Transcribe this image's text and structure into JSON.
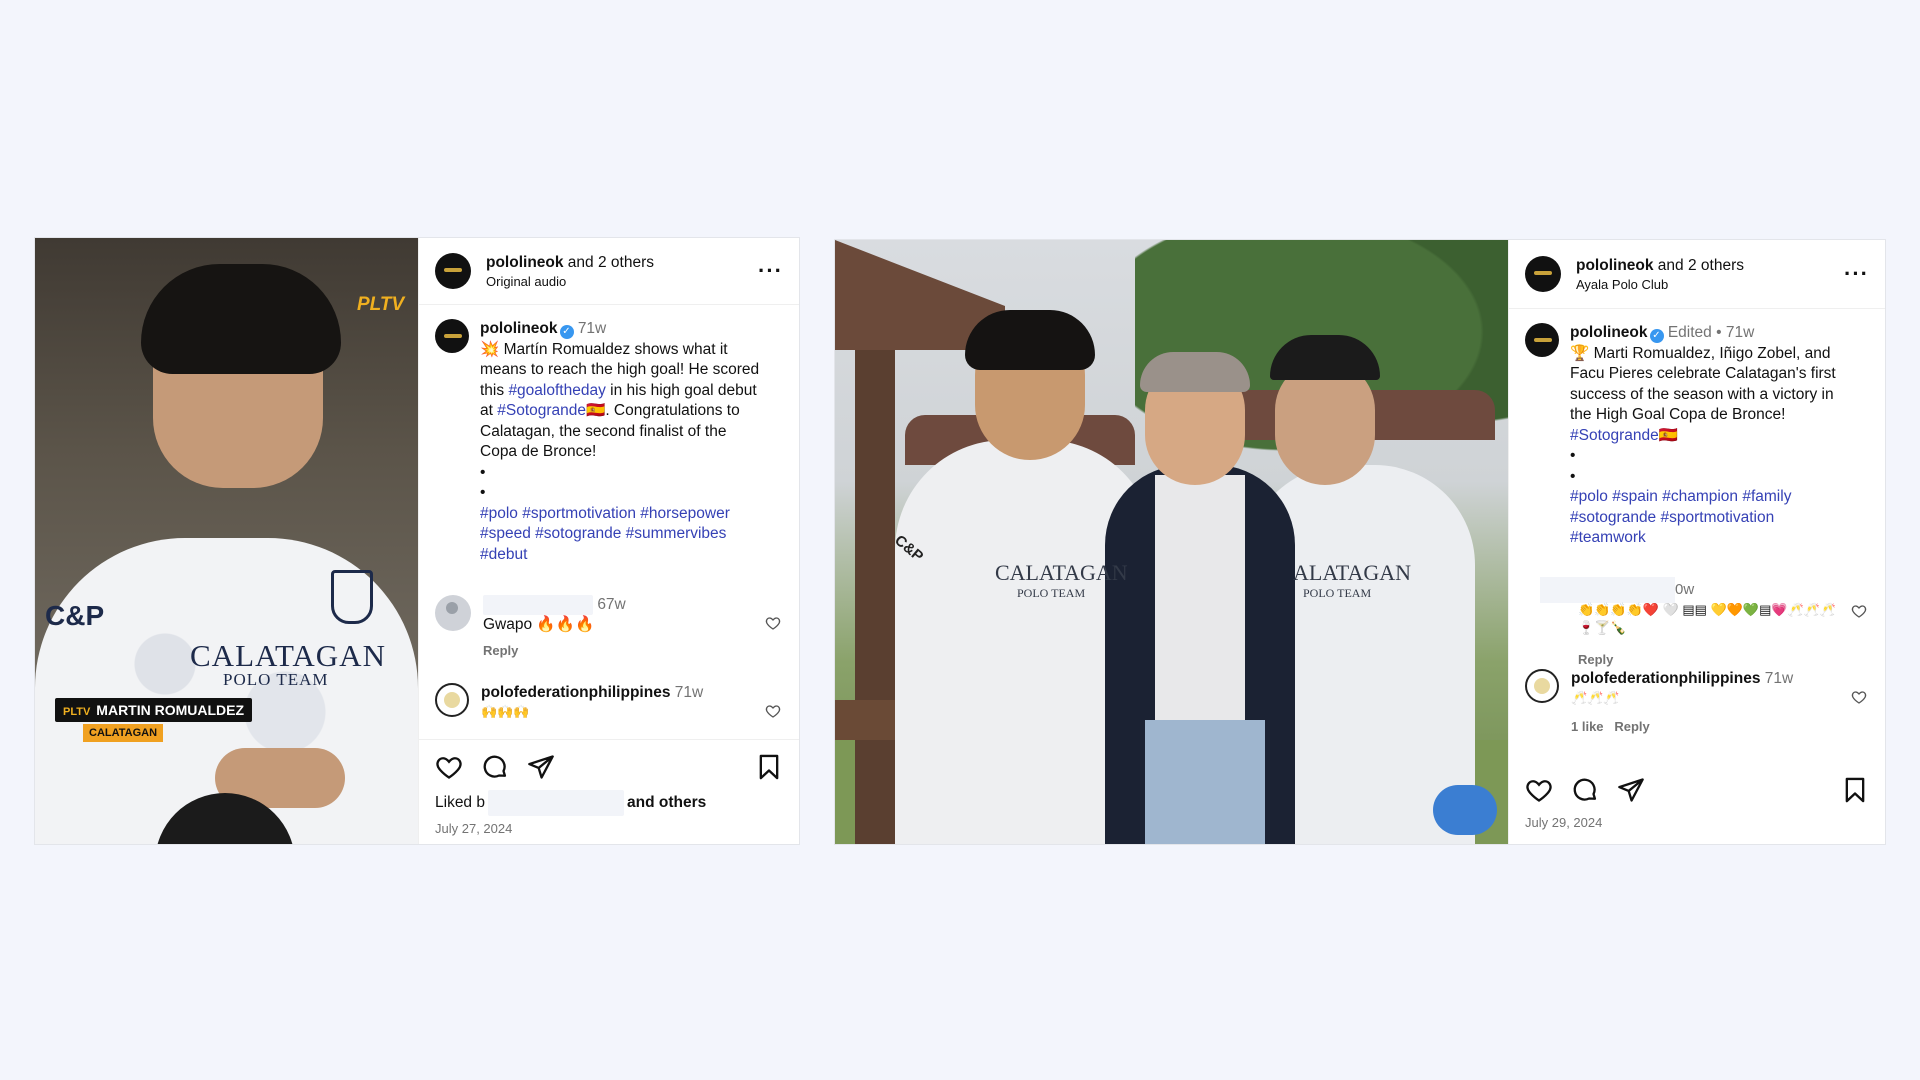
{
  "post1": {
    "header_user": "pololineok",
    "header_others": " and 2 others",
    "header_sub": "Original audio",
    "media": {
      "watermark": "PLTV",
      "lower_third_badge": "PLTV",
      "lower_third_name": "MARTIN ROMUALDEZ",
      "lower_third_team": "CALATAGAN",
      "shirt_logo_1": "CALATAGAN",
      "shirt_logo_2": "POLO TEAM",
      "shirt_sponsor": "C&P"
    },
    "caption": {
      "user": "pololineok",
      "time": "71w",
      "lines": [
        "💥 Martín Romualdez shows what it",
        "means to reach the high goal! He scored",
        "this ",
        "#goaloftheday",
        " in his high goal debut",
        "at ",
        "#Sotogrande",
        "🇪🇸. Congratulations to",
        "Calatagan, the second finalist of the",
        "Copa de Bronce!",
        "•",
        "•"
      ],
      "hashtags": [
        "#polo #sportmotivation #horsepower",
        "#speed #sotogrande #summervibes",
        "#debut"
      ]
    },
    "comments": [
      {
        "time": "67w",
        "text": "Gwapo 🔥🔥🔥",
        "reply": "Reply"
      },
      {
        "user": "polofederationphilippines",
        "time": "71w",
        "text": "🙌🙌🙌"
      }
    ],
    "liked_prefix": "Liked b",
    "liked_suffix": "and others",
    "date": "July 27, 2024"
  },
  "post2": {
    "header_user": "pololineok",
    "header_others": " and 2 others",
    "header_sub": "Ayala Polo Club",
    "media": {
      "shirt_logo_left": "CALATAGAN",
      "shirt_logo_left_sub": "POLO TEAM",
      "shirt_logo_right": "ALATAGAN",
      "shirt_logo_right_sub": "POLO TEAM",
      "shirt_sponsor": "C&P"
    },
    "caption": {
      "user": "pololineok",
      "edited": "Edited",
      "sep": "•",
      "time": "71w",
      "lines": [
        "🏆 Marti Romualdez, Iñigo Zobel, and",
        "Facu Pieres celebrate Calatagan's first",
        "success of the season with a victory in",
        "the High Goal Copa de Bronce!",
        "#Sotogrande",
        "🇪🇸",
        "•",
        "•"
      ],
      "hashtags": [
        "#polo #spain #champion #family",
        "#sotogrande #sportmotivation",
        "#teamwork"
      ]
    },
    "comments": [
      {
        "time_partial": "0w",
        "text_1": "👏👏👏👏❤️ 🤍 ▤▤ 💛🧡💚▤💗🥂🥂🥂",
        "text_2": "🍷🍸🍾",
        "reply": "Reply"
      },
      {
        "user": "polofederationphilippines",
        "time": "71w",
        "text": "🥂🥂🥂",
        "likes": "1 like",
        "reply": "Reply"
      }
    ],
    "date": "July 29, 2024"
  }
}
